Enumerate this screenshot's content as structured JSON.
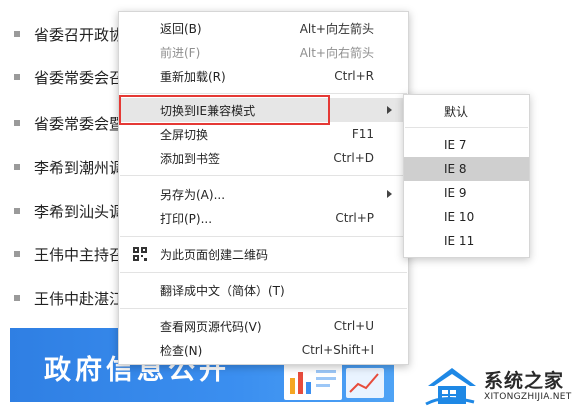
{
  "news": [
    {
      "text": "省委召开政协"
    },
    {
      "text": "省委常委会召"
    },
    {
      "text": "省委常委会暨"
    },
    {
      "text": "李希到潮州调"
    },
    {
      "text": "李希到汕头调"
    },
    {
      "text": "王伟中主持召"
    },
    {
      "text": "王伟中赴湛江"
    }
  ],
  "banner": {
    "title": "政府信息公开"
  },
  "watermark": {
    "name": "系统之家",
    "url": "XITONGZHIJIA.NET"
  },
  "menu": {
    "back": {
      "label": "返回(B)",
      "shortcut": "Alt+向左箭头"
    },
    "forward": {
      "label": "前进(F)",
      "shortcut": "Alt+向右箭头"
    },
    "reload": {
      "label": "重新加载(R)",
      "shortcut": "Ctrl+R"
    },
    "ie_mode": {
      "label": "切换到IE兼容模式"
    },
    "fullscreen": {
      "label": "全屏切换",
      "shortcut": "F11"
    },
    "bookmark": {
      "label": "添加到书签",
      "shortcut": "Ctrl+D"
    },
    "save_as": {
      "label": "另存为(A)..."
    },
    "print": {
      "label": "打印(P)...",
      "shortcut": "Ctrl+P"
    },
    "qrcode": {
      "label": "为此页面创建二维码"
    },
    "translate": {
      "label": "翻译成中文（简体）(T)"
    },
    "view_source": {
      "label": "查看网页源代码(V)",
      "shortcut": "Ctrl+U"
    },
    "inspect": {
      "label": "检查(N)",
      "shortcut": "Ctrl+Shift+I"
    }
  },
  "submenu": {
    "default": "默认",
    "ie7": "IE 7",
    "ie8": "IE 8",
    "ie9": "IE 9",
    "ie10": "IE 10",
    "ie11": "IE 11",
    "selected": "IE 8"
  },
  "colors": {
    "highlight_box": "#e53935",
    "banner": "#3b8ff0"
  }
}
